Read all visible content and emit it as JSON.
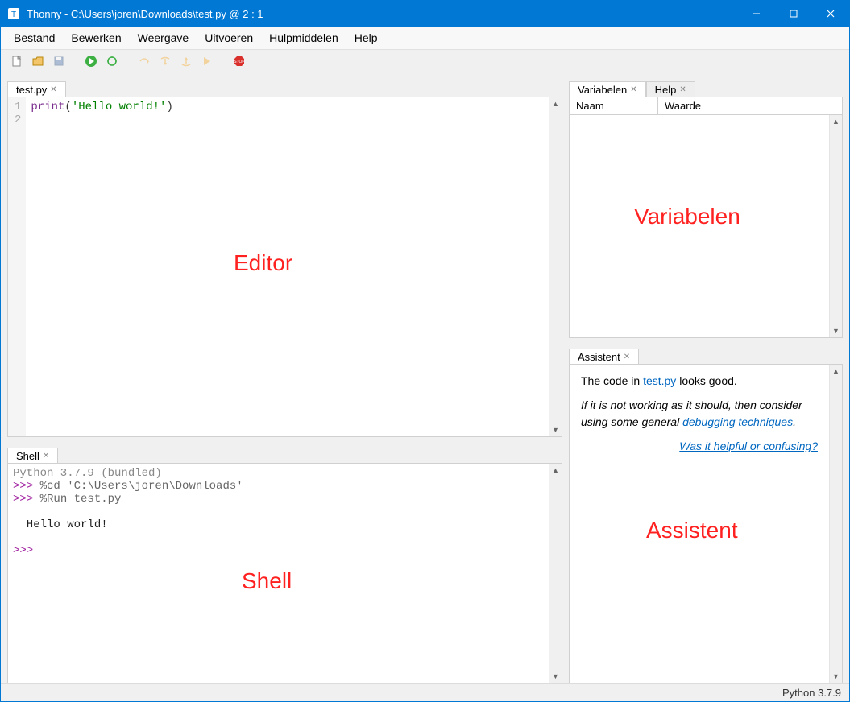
{
  "titlebar": {
    "title": "Thonny  -  C:\\Users\\joren\\Downloads\\test.py  @  2 : 1"
  },
  "menu": {
    "items": [
      "Bestand",
      "Bewerken",
      "Weergave",
      "Uitvoeren",
      "Hulpmiddelen",
      "Help"
    ]
  },
  "editor": {
    "tab_label": "test.py",
    "line1_no": "1",
    "line2_no": "2",
    "code_fn": "print",
    "code_open": "(",
    "code_str": "'Hello world!'",
    "code_close": ")",
    "annotation": "Editor"
  },
  "shell": {
    "tab_label": "Shell",
    "version": "Python 3.7.9 (bundled)",
    "prompt": ">>> ",
    "cd_line": "%cd 'C:\\Users\\joren\\Downloads'",
    "run_line": "%Run test.py",
    "output": "  Hello world!",
    "annotation": "Shell"
  },
  "variables": {
    "tab_a": "Variabelen",
    "tab_b": "Help",
    "col_name": "Naam",
    "col_value": "Waarde",
    "annotation": "Variabelen"
  },
  "assistant": {
    "tab_label": "Assistent",
    "para1_a": "The code in ",
    "para1_link": "test.py",
    "para1_b": " looks good.",
    "para2_a": "If it is not working as it should, then consider using some general ",
    "para2_link": "debugging techniques",
    "para2_b": ".",
    "helpful_link": "Was it helpful or confusing?",
    "annotation": "Assistent"
  },
  "statusbar": {
    "python": "Python 3.7.9"
  }
}
